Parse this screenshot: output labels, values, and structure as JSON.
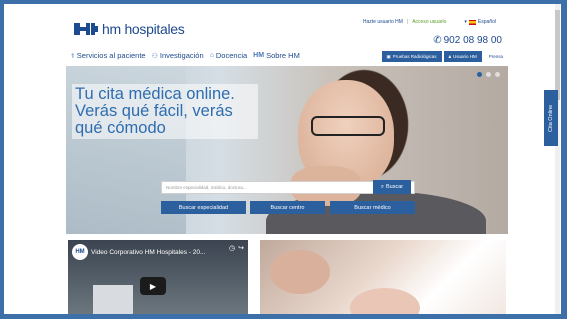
{
  "brand": {
    "logo_mark": "HM",
    "name": "hm hospitales",
    "primary_color": "#2c5f9e"
  },
  "topbar": {
    "hazte": "Hazte usuario HM",
    "separator": "|",
    "acceso": "Acceso usuario",
    "language": "Español"
  },
  "phone": "902 08 98 00",
  "nav": [
    {
      "label": "Servicios al paciente",
      "icon": "stethoscope-icon"
    },
    {
      "label": "Investigación",
      "icon": "people-icon"
    },
    {
      "label": "Docencia",
      "icon": "graduation-cap-icon"
    },
    {
      "label": "Sobre HM",
      "icon": "hm-logo-icon"
    }
  ],
  "nav_buttons": {
    "pruebas": "Pruebas Radiológicas",
    "usuario": "Usuario HM",
    "prensa": "Prensa"
  },
  "hero": {
    "headline": "Tu cita médica online. Verás qué fácil, verás qué cómodo",
    "search_placeholder": "Nombre especialidad, médico, doctora...",
    "search_button": "Buscar",
    "buttons": [
      "Buscar especialidad",
      "Buscar centro",
      "Buscar médico"
    ]
  },
  "video": {
    "title": "Video Corporativo HM Hospitales - 20..."
  },
  "side_tab": "Cita Online"
}
